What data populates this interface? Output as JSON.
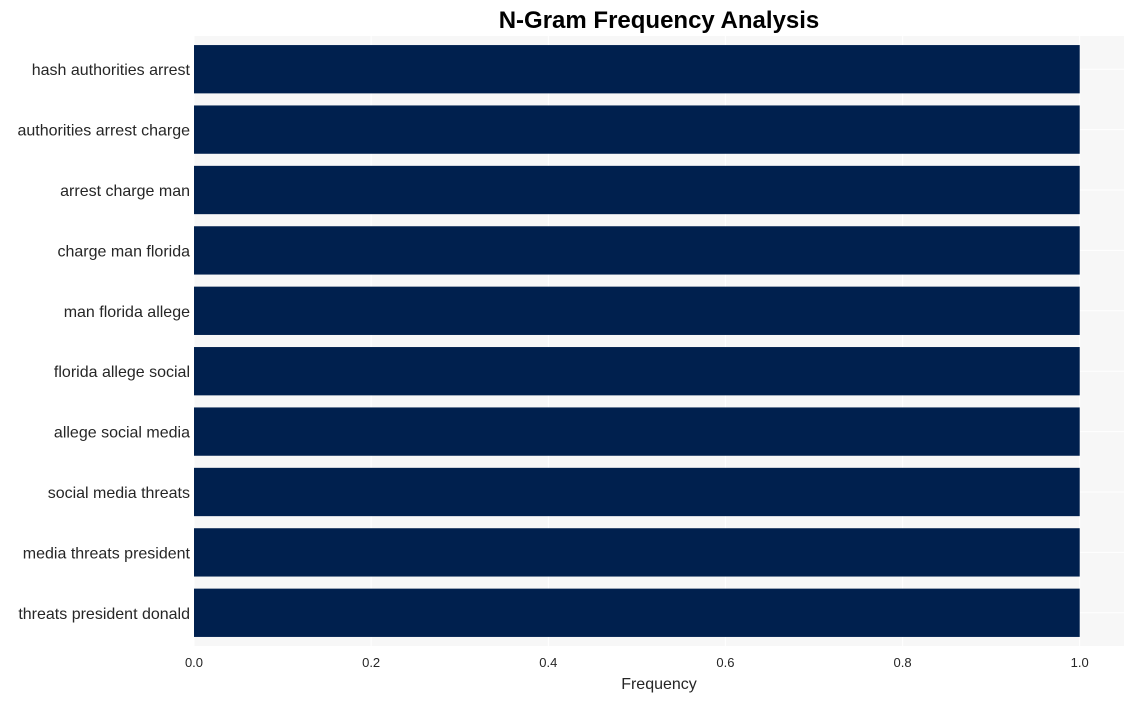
{
  "chart_data": {
    "type": "bar",
    "orientation": "horizontal",
    "title": "N-Gram Frequency Analysis",
    "xlabel": "Frequency",
    "ylabel": "",
    "categories": [
      "hash authorities arrest",
      "authorities arrest charge",
      "arrest charge man",
      "charge man florida",
      "man florida allege",
      "florida allege social",
      "allege social media",
      "social media threats",
      "media threats president",
      "threats president donald"
    ],
    "values": [
      1,
      1,
      1,
      1,
      1,
      1,
      1,
      1,
      1,
      1
    ],
    "xlim": [
      0,
      1.05
    ],
    "xticks": [
      0.0,
      0.2,
      0.4,
      0.6,
      0.8,
      1.0
    ],
    "xtick_labels": [
      "0.0",
      "0.2",
      "0.4",
      "0.6",
      "0.8",
      "1.0"
    ],
    "grid": true,
    "legend": "none",
    "colors": {
      "bar": "#00204e",
      "plot_background": "#f7f7f7",
      "grid": "#ffffff"
    }
  }
}
